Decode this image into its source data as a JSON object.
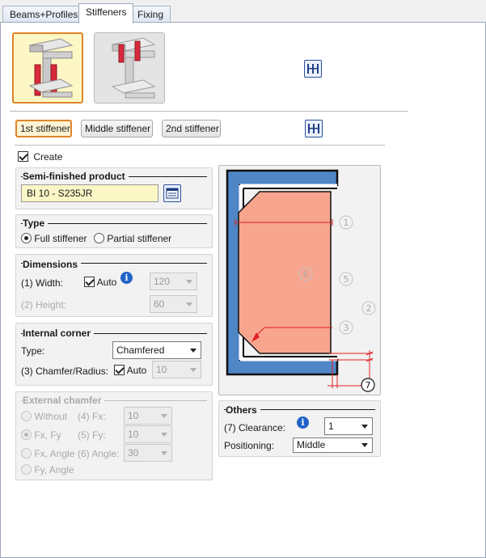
{
  "tabs": [
    "Beams+Profiles",
    "Stiffeners",
    "Fixing"
  ],
  "stiffener_tabs": [
    "1st stiffener",
    "Middle stiffener",
    "2nd stiffener"
  ],
  "create": {
    "label": "Create",
    "checked": true
  },
  "semi_finished": {
    "title": "Semi-finished product",
    "value": "BI 10 - S235JR"
  },
  "type": {
    "title": "Type",
    "options": [
      "Full stiffener",
      "Partial stiffener"
    ],
    "selected": "Full stiffener"
  },
  "dimensions": {
    "title": "Dimensions",
    "width_label": "(1) Width:",
    "auto_label": "Auto",
    "width_value": "120",
    "height_label": "(2) Height:",
    "height_value": "60"
  },
  "internal_corner": {
    "title": "Internal corner",
    "type_label": "Type:",
    "type_value": "Chamfered",
    "chamfer_label": "(3) Chamfer/Radius:",
    "auto_label": "Auto",
    "chamfer_value": "10"
  },
  "external_chamfer": {
    "title": "External chamfer",
    "options": [
      "Without",
      "Fx, Fy",
      "Fx, Angle",
      "Fy, Angle"
    ],
    "selected": "Fx, Fy",
    "fx_label": "(4) Fx:",
    "fx_value": "10",
    "fy_label": "(5) Fy:",
    "fy_value": "10",
    "angle_label": "(6) Angle:",
    "angle_value": "30"
  },
  "others": {
    "title": "Others",
    "clearance_label": "(7) Clearance:",
    "clearance_value": "1",
    "positioning_label": "Positioning:",
    "positioning_value": "Middle"
  },
  "diagram_labels": [
    "1",
    "2",
    "3",
    "5",
    "6",
    "7"
  ],
  "colors": {
    "accent_orange": "#e0852a",
    "selected_fill": "#fdf7c6",
    "profile_blue": "#4f86c6",
    "stiffener_fill": "#f7a58f",
    "dimension_red": "#e02020"
  },
  "icons": [
    "stiffener-full-icon",
    "stiffener-partial-icon",
    "distribute-icon",
    "catalog-icon",
    "info-icon"
  ]
}
